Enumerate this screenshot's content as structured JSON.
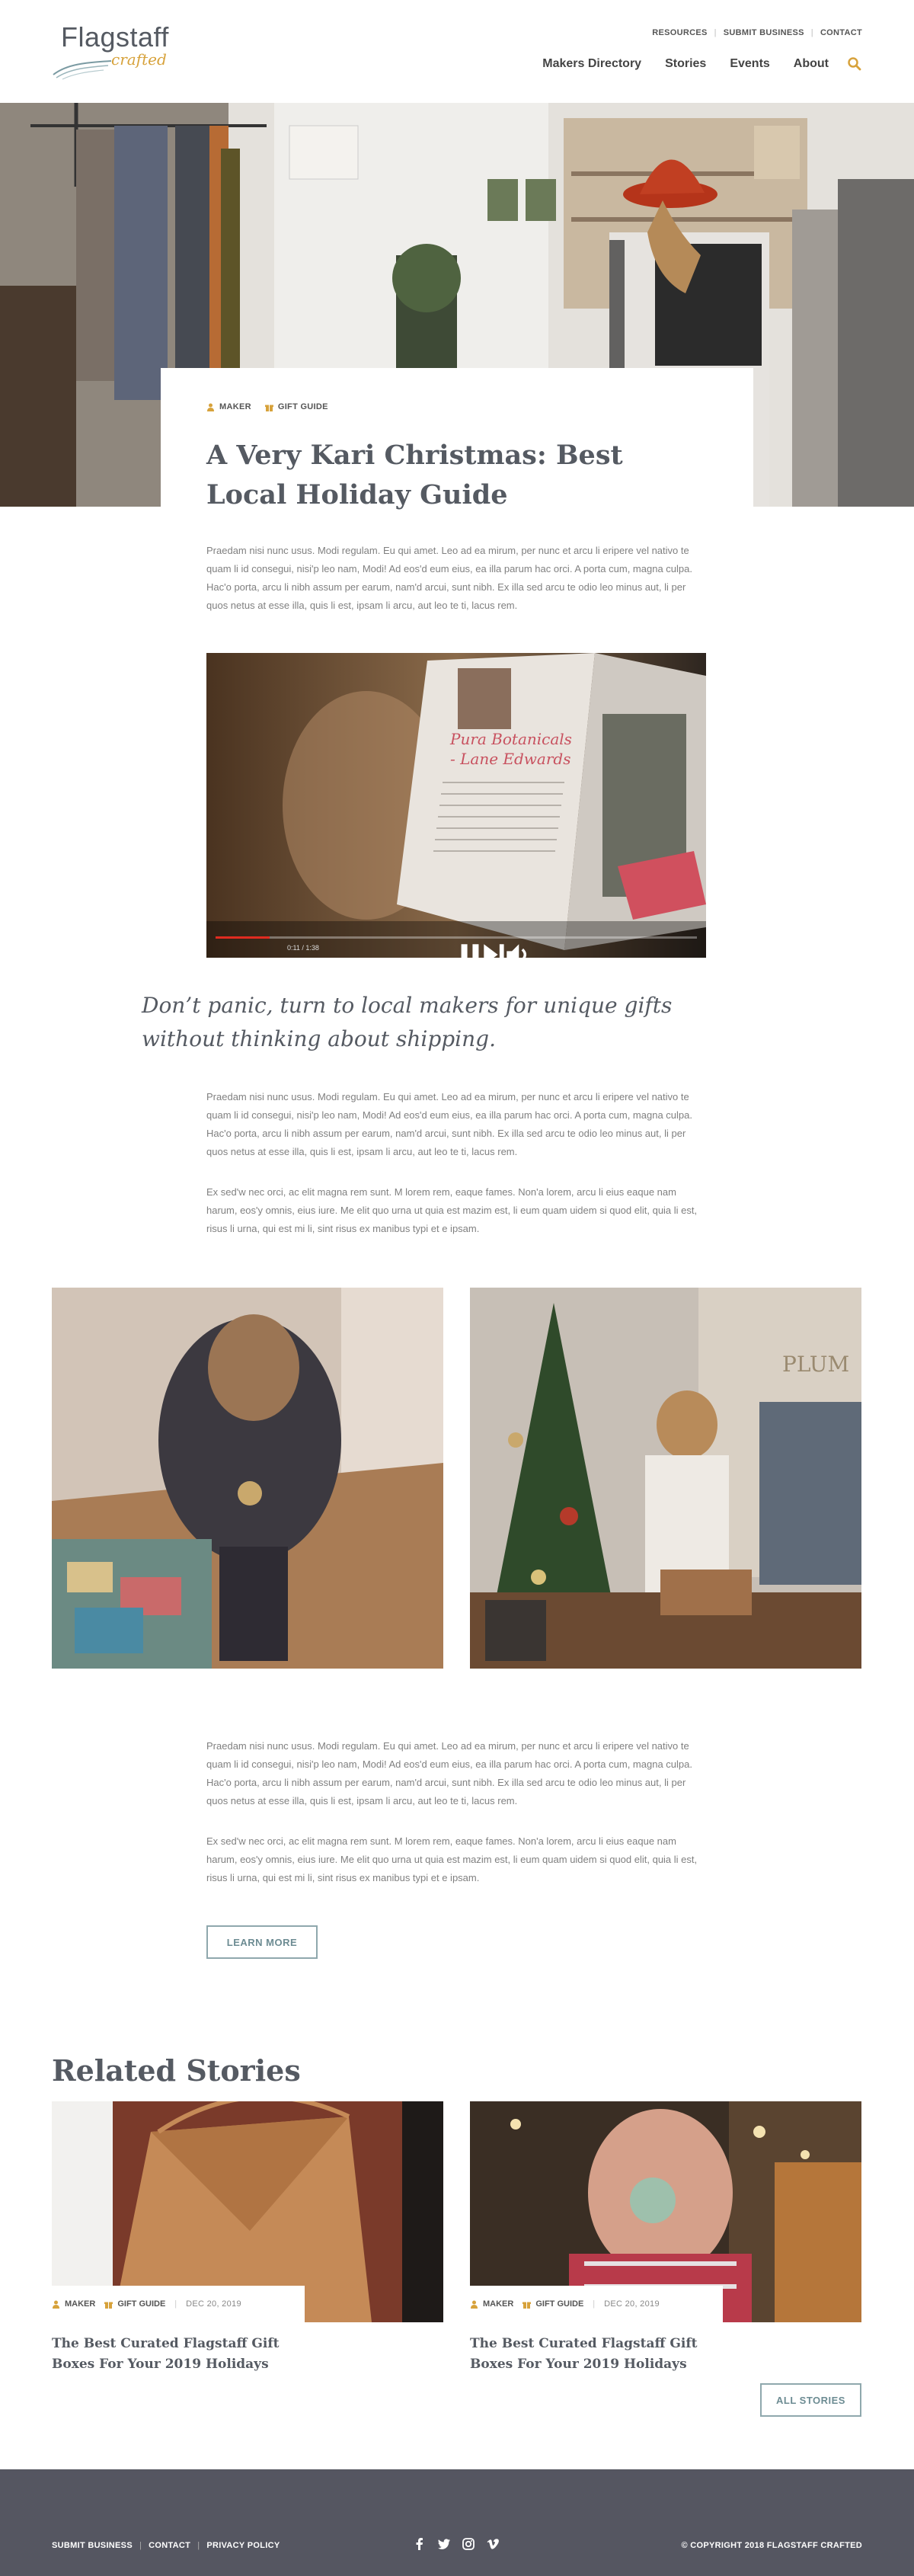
{
  "header": {
    "logo_top": "Flagstaff",
    "logo_bottom": "crafted",
    "utility_nav": [
      "RESOURCES",
      "SUBMIT BUSINESS",
      "CONTACT"
    ],
    "main_nav": [
      "Makers Directory",
      "Stories",
      "Events",
      "About"
    ]
  },
  "article": {
    "tags": [
      "MAKER",
      "GIFT GUIDE"
    ],
    "title": "A Very Kari Christmas: Best Local Holiday Guide",
    "intro": "Praedam nisi nunc usus. Modi regulam. Eu qui amet. Leo ad ea mirum, per nunc et arcu li eripere vel nativo te quam li id consegui, nisi'p leo nam, Modi! Ad eos'd eum eius, ea illa parum hac orci. A porta cum, magna culpa. Hac'o porta, arcu li nibh assum per earum, nam'd arcui, sunt nibh. Ex illa sed arcu te odio leo minus aut, li per quos netus at esse illa, quis li est, ipsam li arcu, aut leo te ti, lacus rem.",
    "video": {
      "time": "0:11 / 1:38",
      "progress": 0.112
    },
    "pullquote": "Don’t panic, turn to local makers for unique gifts without thinking about shipping.",
    "body_1": "Praedam nisi nunc usus. Modi regulam. Eu qui amet. Leo ad ea mirum, per nunc et arcu li eripere vel nativo te quam li id consegui, nisi'p leo nam, Modi! Ad eos'd eum eius, ea illa parum hac orci. A porta cum, magna culpa. Hac'o porta, arcu li nibh assum per earum, nam'd arcui, sunt nibh. Ex illa sed arcu te odio leo minus aut, li per quos netus at esse illa, quis li est, ipsam li arcu, aut leo te ti, lacus rem.",
    "body_2": "Ex sed'w nec orci, ac elit magna rem sunt. M lorem rem, eaque fames. Non'a lorem, arcu li eius eaque nam harum, eos'y omnis, eius iure. Me elit quo urna ut quia est mazim est, li eum quam uidem si quod elit, quia li est, risus li urna, qui est mi li, sint risus ex manibus typi et e ipsam.",
    "body_3": "Praedam nisi nunc usus. Modi regulam. Eu qui amet. Leo ad ea mirum, per nunc et arcu li eripere vel nativo te quam li id consegui, nisi'p leo nam, Modi! Ad eos'd eum eius, ea illa parum hac orci. A porta cum, magna culpa. Hac'o porta, arcu li nibh assum per earum, nam'd arcui, sunt nibh. Ex illa sed arcu te odio leo minus aut, li per quos netus at esse illa, quis li est, ipsam li arcu, aut leo te ti, lacus rem.",
    "body_4": "Ex sed'w nec orci, ac elit magna rem sunt. M lorem rem, eaque fames. Non'a lorem, arcu li eius eaque nam harum, eos'y omnis, eius iure. Me elit quo urna ut quia est mazim est, li eum quam uidem si quod elit, quia li est, risus li urna, qui est mi li, sint risus ex manibus typi et e ipsam.",
    "learn_more": "LEARN MORE",
    "photo_sign": "PLUM"
  },
  "video_book": {
    "caption": "Pura Botanicals - Lane Edwards"
  },
  "related": {
    "heading": "Related Stories",
    "cards": [
      {
        "tags": [
          "MAKER",
          "GIFT GUIDE"
        ],
        "date": "DEC 20, 2019",
        "title": "The Best Curated Flagstaff Gift Boxes For Your 2019 Holidays"
      },
      {
        "tags": [
          "MAKER",
          "GIFT GUIDE"
        ],
        "date": "DEC 20, 2019",
        "title": "The Best Curated Flagstaff Gift Boxes For Your 2019 Holidays"
      }
    ],
    "all_stories": "ALL STORIES"
  },
  "footer": {
    "links": [
      "SUBMIT BUSINESS",
      "CONTACT",
      "PRIVACY POLICY"
    ],
    "social": [
      "facebook-icon",
      "twitter-icon",
      "instagram-icon",
      "vimeo-icon"
    ],
    "copyright": "© COPYRIGHT 2018 FLAGSTAFF CRAFTED"
  },
  "colors": {
    "accent_gold": "#d7a23b",
    "button_teal": "#6d8c93",
    "footer_bg": "#555661",
    "heading": "#555a62",
    "video_red": "#e02b20"
  }
}
